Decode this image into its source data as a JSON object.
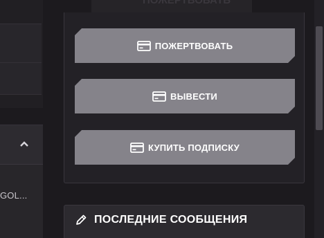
{
  "left": {
    "truncated_text": "GOL..."
  },
  "header": {
    "faded_text": "ПОЖЕРТВОВАТЬ"
  },
  "actions": {
    "donate_label": "ПОЖЕРТВОВАТЬ",
    "withdraw_label": "ВЫВЕСТИ",
    "subscribe_label": "КУПИТЬ ПОДПИСКУ"
  },
  "messages": {
    "title": "ПОСЛЕДНИЕ СООБЩЕНИЯ"
  },
  "icons": {
    "button_icon": "credit-card-icon",
    "messages_icon": "pencil-icon",
    "collapse_icon": "chevron-up-icon"
  },
  "colors": {
    "button_bg": "#85838a",
    "panel_bg": "#232126",
    "page_bg": "#1c1a1e",
    "text": "#ffffff"
  }
}
